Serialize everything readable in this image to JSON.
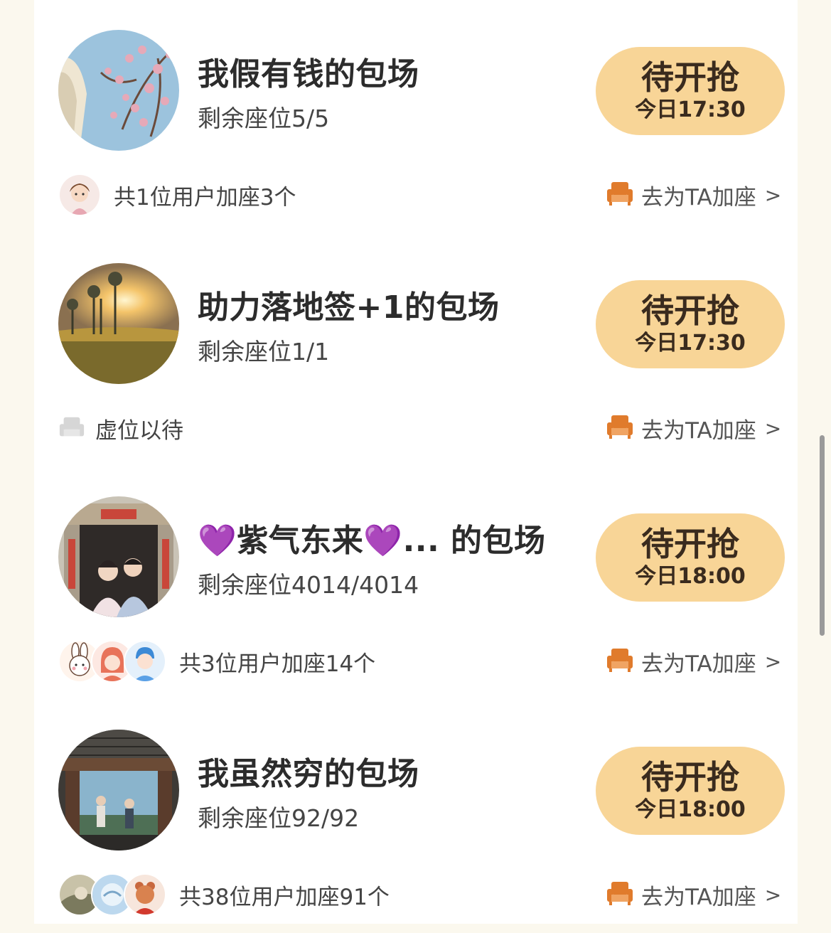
{
  "items": [
    {
      "title": "我假有钱的包场",
      "seats": "剩余座位5/5",
      "button_main": "待开抢",
      "button_time": "今日17:30",
      "footer": "共1位用户加座3个",
      "add_seat": "去为TA加座",
      "chevron": ">"
    },
    {
      "title": "助力落地签+1的包场",
      "seats": "剩余座位1/1",
      "button_main": "待开抢",
      "button_time": "今日17:30",
      "footer": "虚位以待",
      "add_seat": "去为TA加座",
      "chevron": ">"
    },
    {
      "title": "💜紫气东来💜... 的包场",
      "seats": "剩余座位4014/4014",
      "button_main": "待开抢",
      "button_time": "今日18:00",
      "footer": "共3位用户加座14个",
      "add_seat": "去为TA加座",
      "chevron": ">"
    },
    {
      "title": "我虽然穷的包场",
      "seats": "剩余座位92/92",
      "button_main": "待开抢",
      "button_time": "今日18:00",
      "footer": "共38位用户加座91个",
      "add_seat": "去为TA加座",
      "chevron": ">"
    }
  ],
  "colors": {
    "button_bg": "#f8d597",
    "accent_seat": "#e07b2c",
    "page_bg": "#fbf8ee"
  }
}
